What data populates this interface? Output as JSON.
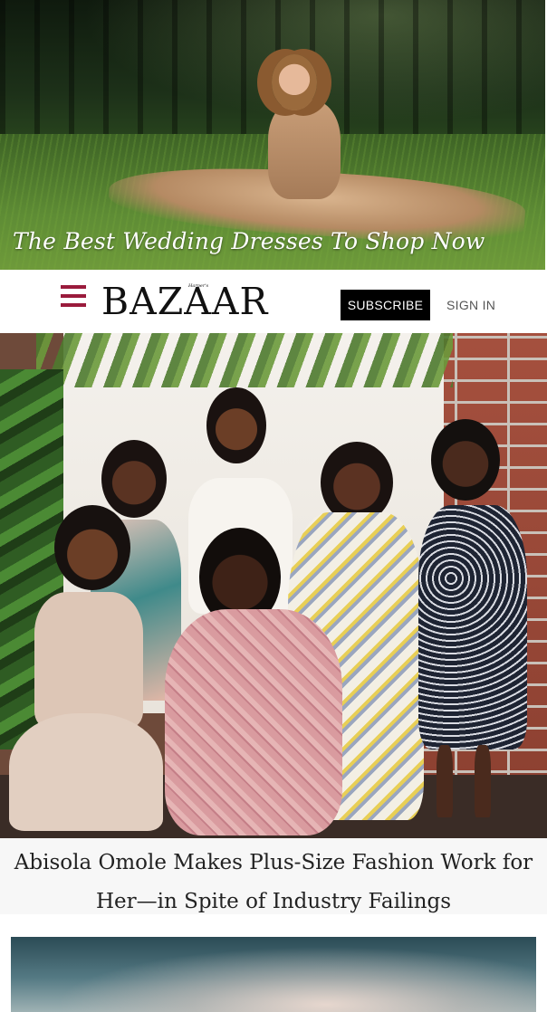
{
  "promo": {
    "caption": "The Best Wedding Dresses To Shop Now"
  },
  "header": {
    "logo_text": "BAZAAR",
    "logo_super": "Harper's",
    "subscribe_label": "SUBSCRIBE",
    "signin_label": "SIGN IN",
    "colors": {
      "menu_icon": "#9a1b3c",
      "subscribe_bg": "#000000"
    }
  },
  "feature": {
    "headline": "Abisola Omole Makes Plus-Size Fashion Work for Her—in Spite of Industry Failings"
  },
  "icons": {
    "menu": "hamburger-icon"
  }
}
